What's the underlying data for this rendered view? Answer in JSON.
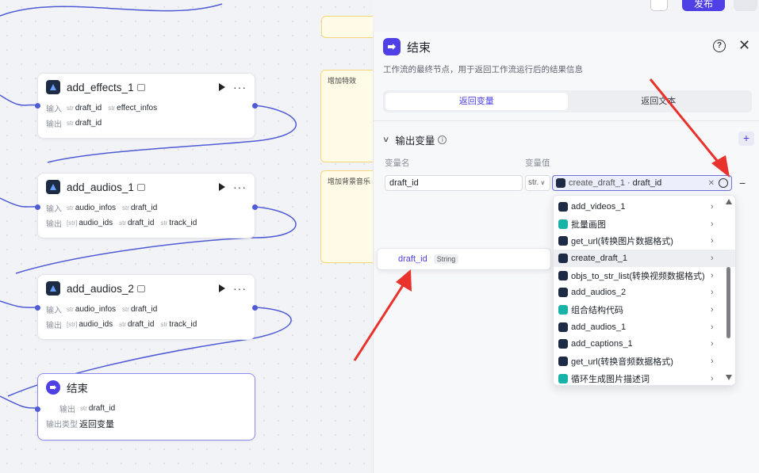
{
  "toolbar": {
    "publish_label": "发布"
  },
  "canvas": {
    "nodes": [
      {
        "title": "add_effects_1",
        "input_label": "输入",
        "inputs": [
          {
            "type": "str",
            "name": "draft_id"
          },
          {
            "type": "str",
            "name": "effect_infos"
          }
        ],
        "output_label": "输出",
        "outputs": [
          {
            "type": "str",
            "name": "draft_id"
          }
        ]
      },
      {
        "title": "add_audios_1",
        "input_label": "输入",
        "inputs": [
          {
            "type": "str",
            "name": "audio_infos"
          },
          {
            "type": "str",
            "name": "draft_id"
          }
        ],
        "output_label": "输出",
        "outputs": [
          {
            "type": "[str]",
            "name": "audio_ids"
          },
          {
            "type": "str",
            "name": "draft_id"
          },
          {
            "type": "str",
            "name": "track_id"
          }
        ]
      },
      {
        "title": "add_audios_2",
        "input_label": "输入",
        "inputs": [
          {
            "type": "str",
            "name": "audio_infos"
          },
          {
            "type": "str",
            "name": "draft_id"
          }
        ],
        "output_label": "输出",
        "outputs": [
          {
            "type": "[str]",
            "name": "audio_ids"
          },
          {
            "type": "str",
            "name": "draft_id"
          },
          {
            "type": "str",
            "name": "track_id"
          }
        ]
      }
    ],
    "end_node": {
      "title": "结束",
      "output_label": "输出",
      "output_type": "str",
      "output_name": "draft_id",
      "output_kind_label": "输出类型",
      "output_kind_value": "返回变量"
    },
    "groups": [
      {
        "label": "增加特效"
      },
      {
        "label": "增加背景音乐"
      }
    ]
  },
  "panel": {
    "title": "结束",
    "description": "工作流的最终节点，用于返回工作流运行后的结果信息",
    "tabs": [
      "返回变量",
      "返回文本"
    ],
    "active_tab": 0,
    "section_title": "输出变量",
    "col_name_label": "变量名",
    "col_value_label": "变量值",
    "var_name": "draft_id",
    "var_type": "str.",
    "ref_node": "create_draft_1",
    "ref_sep": "·",
    "ref_var": "draft_id",
    "suggestion": {
      "name": "draft_id",
      "type": "String"
    },
    "dropdown_items": [
      {
        "label": "add_videos_1",
        "icon": "dark"
      },
      {
        "label": "批量画图",
        "icon": "teal"
      },
      {
        "label": "get_url(转换图片数据格式)",
        "icon": "dark"
      },
      {
        "label": "create_draft_1",
        "icon": "dark",
        "active": true
      },
      {
        "label": "objs_to_str_list(转换视频数据格式)",
        "icon": "dark"
      },
      {
        "label": "add_audios_2",
        "icon": "dark"
      },
      {
        "label": "组合结构代码",
        "icon": "teal"
      },
      {
        "label": "add_audios_1",
        "icon": "dark"
      },
      {
        "label": "add_captions_1",
        "icon": "dark"
      },
      {
        "label": "get_url(转换音频数据格式)",
        "icon": "dark"
      },
      {
        "label": "循环生成图片描述词",
        "icon": "teal"
      }
    ]
  },
  "colors": {
    "accent": "#4e40e5",
    "arrow": "#e8322b",
    "edge": "#4f5bd5"
  }
}
